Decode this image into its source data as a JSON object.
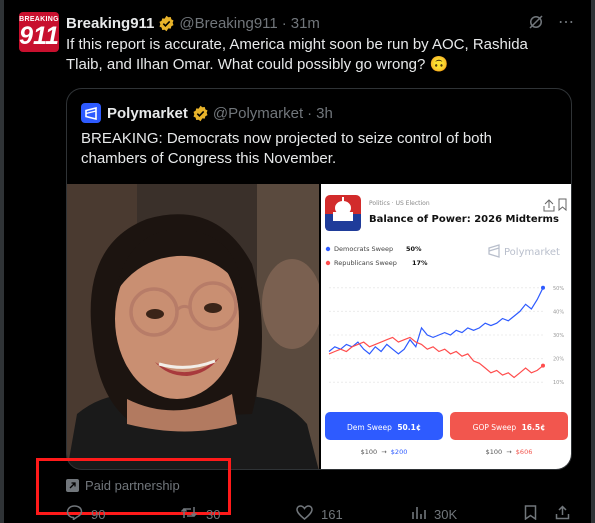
{
  "tweet": {
    "avatar_top": "BREAKING",
    "avatar_num": "911",
    "name": "Breaking911",
    "handle": "@Breaking911",
    "separator": "·",
    "time": "31m",
    "text": "If this report is accurate, America might soon be run by AOC, Rashida Tlaib, and Ilhan Omar. What could possibly go wrong? 🙃"
  },
  "quote": {
    "name": "Polymarket",
    "handle": "@Polymarket",
    "separator": "·",
    "time": "3h",
    "text": "BREAKING: Democrats now projected to seize control of both chambers of Congress this November."
  },
  "card": {
    "category": "Politics · US Election",
    "title": "Balance of Power: 2026 Midterms",
    "brand": "Polymarket",
    "legend": [
      {
        "label": "Democrats Sweep",
        "value": "50%",
        "color": "#2e5bff"
      },
      {
        "label": "Republicans Sweep",
        "value": "17%",
        "color": "#ff4d4d"
      }
    ],
    "y_ticks": [
      "50%",
      "40%",
      "30%",
      "20%",
      "10%"
    ],
    "buttons": [
      {
        "label": "Dem Sweep",
        "price": "50.1¢",
        "payout_from": "$100",
        "arrow": "→",
        "payout_to": "$200",
        "color": "#2e5bff"
      },
      {
        "label": "GOP Sweep",
        "price": "16.5¢",
        "payout_from": "$100",
        "arrow": "→",
        "payout_to": "$606",
        "color": "#f2564e"
      }
    ]
  },
  "chart_data": {
    "type": "line",
    "title": "Balance of Power: 2026 Midterms",
    "xlabel": "",
    "ylabel": "",
    "ylim": [
      5,
      55
    ],
    "y_ticks": [
      10,
      20,
      30,
      40,
      50
    ],
    "series": [
      {
        "name": "Democrats Sweep",
        "color": "#2e5bff",
        "values": [
          23,
          25,
          24,
          26,
          25,
          27,
          24,
          22,
          25,
          23,
          26,
          24,
          22,
          24,
          28,
          25,
          33,
          30,
          29,
          30,
          31,
          30,
          32,
          31,
          33,
          32,
          33,
          35,
          34,
          35,
          37,
          36,
          38,
          40,
          43,
          41,
          45,
          50
        ]
      },
      {
        "name": "Republicans Sweep",
        "color": "#ff4d4d",
        "values": [
          22,
          23,
          24,
          23,
          25,
          26,
          27,
          25,
          26,
          27,
          28,
          29,
          27,
          28,
          29,
          27,
          26,
          24,
          25,
          23,
          24,
          22,
          23,
          21,
          22,
          19,
          18,
          16,
          14,
          15,
          13,
          14,
          12,
          14,
          16,
          14,
          15,
          17
        ]
      }
    ]
  },
  "footer": {
    "paid_label": "Paid partnership",
    "replies": "90",
    "reposts": "30",
    "likes": "161",
    "views": "30K"
  }
}
